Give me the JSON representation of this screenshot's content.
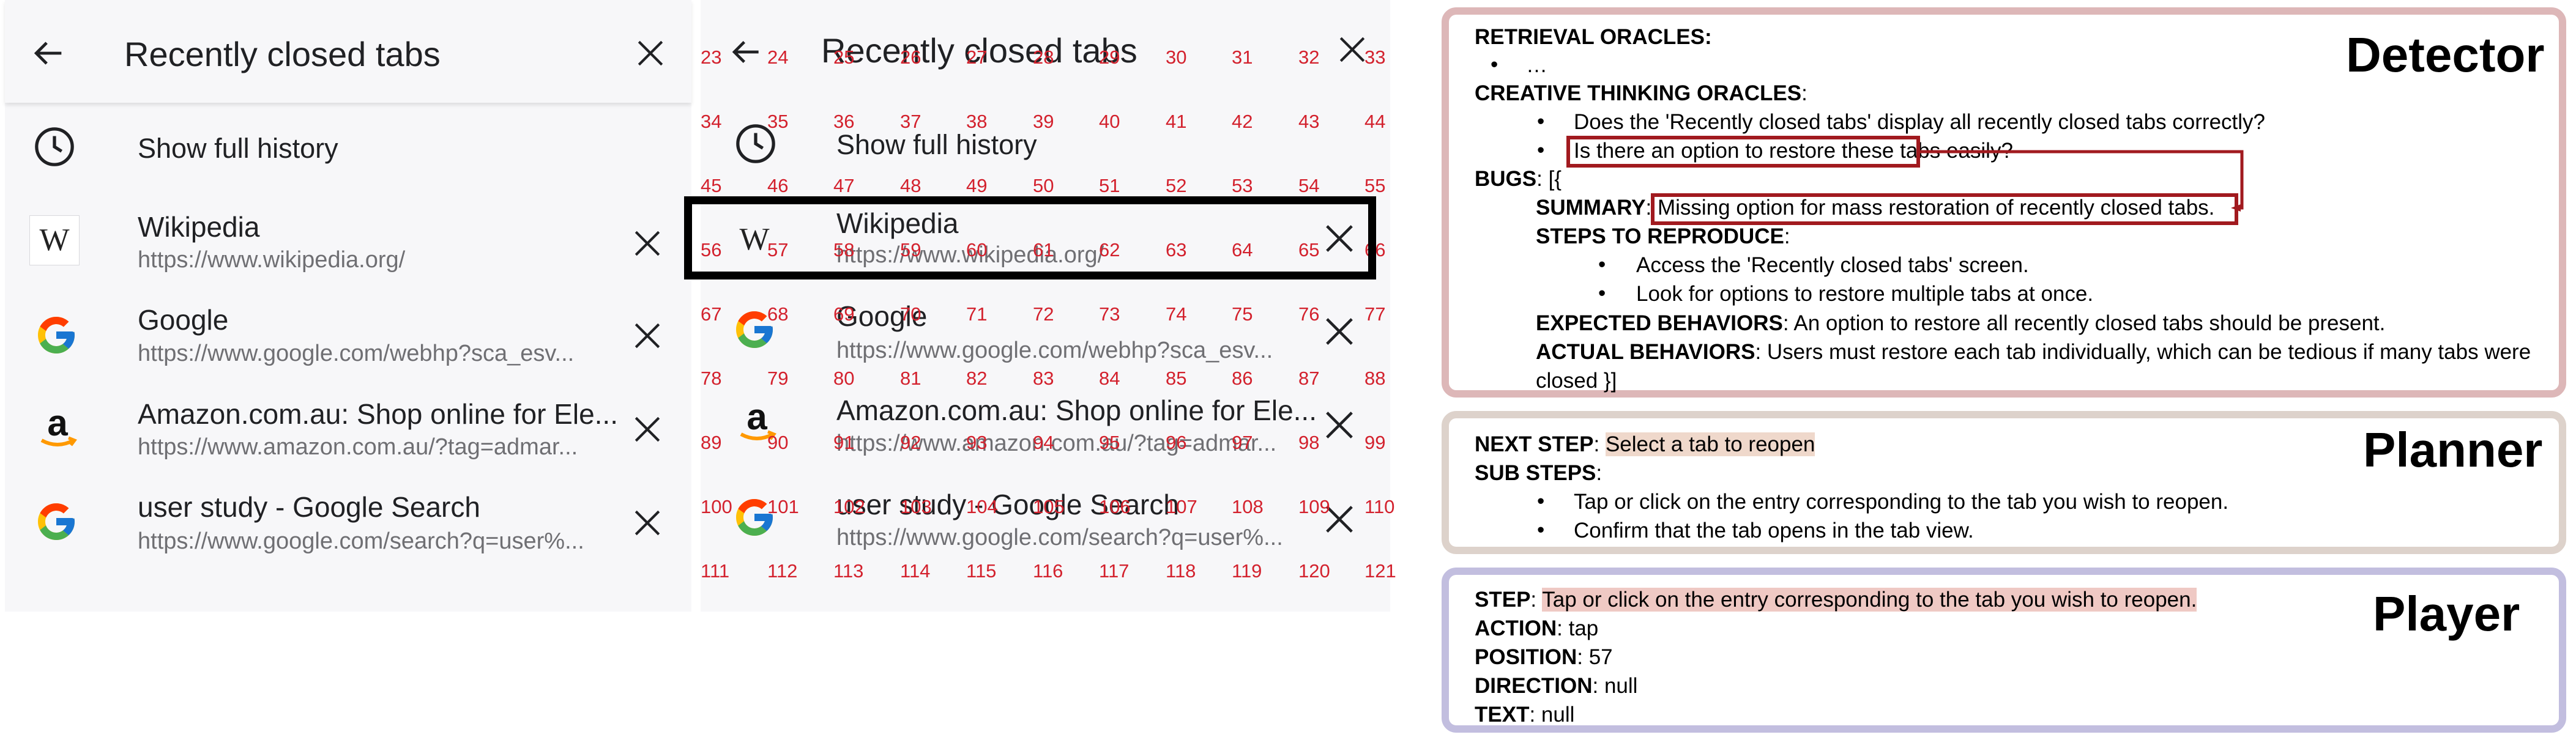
{
  "left_phone": {
    "title": "Recently closed tabs",
    "show_full_history": "Show full history",
    "rows": [
      {
        "title": "Wikipedia",
        "url": "https://www.wikipedia.org/",
        "icon": "wikipedia-icon"
      },
      {
        "title": "Google",
        "url": "https://www.google.com/webhp?sca_esv...",
        "icon": "google-icon"
      },
      {
        "title": "Amazon.com.au: Shop online for Ele...",
        "url": "https://www.amazon.com.au/?tag=admar...",
        "icon": "amazon-icon"
      },
      {
        "title": "user study - Google Search",
        "url": "https://www.google.com/search?q=user%...",
        "icon": "google-icon"
      }
    ]
  },
  "right_phone": {
    "title": "Recently closed tabs",
    "show_full_history": "Show full history",
    "rows": [
      {
        "title": "Wikipedia",
        "url": "https://www.wikipedia.org/"
      },
      {
        "title": "Google",
        "url": "https://www.google.com/webhp?sca_esv..."
      },
      {
        "title": "Amazon.com.au: Shop online for Ele...",
        "url": "https://www.amazon.com.au/?tag=admar..."
      },
      {
        "title": "user study - Google Search",
        "url": "https://www.google.com/search?q=user%..."
      }
    ],
    "grid_labels": [
      [
        "23",
        "24",
        "25",
        "26",
        "27",
        "28",
        "29",
        "30",
        "31",
        "32",
        "33"
      ],
      [
        "34",
        "35",
        "36",
        "37",
        "38",
        "39",
        "40",
        "41",
        "42",
        "43",
        "44"
      ],
      [
        "45",
        "46",
        "47",
        "48",
        "49",
        "50",
        "51",
        "52",
        "53",
        "54",
        "55"
      ],
      [
        "56",
        "57",
        "58",
        "59",
        "60",
        "61",
        "62",
        "63",
        "64",
        "65",
        "66"
      ],
      [
        "67",
        "68",
        "69",
        "70",
        "71",
        "72",
        "73",
        "74",
        "75",
        "76",
        "77"
      ],
      [
        "78",
        "79",
        "80",
        "81",
        "82",
        "83",
        "84",
        "85",
        "86",
        "87",
        "88"
      ],
      [
        "89",
        "90",
        "91",
        "92",
        "93",
        "94",
        "95",
        "96",
        "97",
        "98",
        "99"
      ],
      [
        "100",
        "101",
        "102",
        "103",
        "104",
        "105",
        "106",
        "107",
        "108",
        "109",
        "110"
      ],
      [
        "111",
        "112",
        "113",
        "114",
        "115",
        "116",
        "117",
        "118",
        "119",
        "120",
        "121"
      ]
    ]
  },
  "detector": {
    "title": "Detector",
    "retrieval_label": "RETRIEVAL ORACLES:",
    "retrieval_item": "…",
    "creative_label": "CREATIVE THINKING ORACLES",
    "creative_colon": ":",
    "creative_items": [
      "Does the 'Recently closed tabs' display all recently closed tabs correctly?",
      "Is there an option to restore these tabs easily?"
    ],
    "bugs_label": "BUGS",
    "bugs_open": ": [{",
    "summary_label": "SUMMARY",
    "summary_text": "Missing option for mass restoration of recently closed tabs.",
    "steps_label": "STEPS TO REPRODUCE",
    "steps_colon": ":",
    "steps": [
      "Access the 'Recently closed tabs' screen.",
      "Look for options to restore multiple tabs at once."
    ],
    "expected_label": "EXPECTED BEHAVIORS",
    "expected_text": ": An option to restore all recently closed tabs should be present.",
    "actual_label": "ACTUAL BEHAVIORS",
    "actual_text": ": Users must restore each tab individually, which can be tedious if many tabs were",
    "actual_text_2": "closed }]",
    "colon": ": "
  },
  "planner": {
    "title": "Planner",
    "next_step_label": "NEXT STEP",
    "next_step_text": "Select a tab to reopen",
    "sub_steps_label": "SUB STEPS",
    "sub_steps_colon": ":",
    "sub_steps": [
      "Tap or click on the entry corresponding to the tab you wish to reopen.",
      "Confirm that the tab opens in the tab view."
    ],
    "colon": ": "
  },
  "player": {
    "title": "Player",
    "step_label": "STEP",
    "step_text": "Tap or click on the entry corresponding to the tab you wish to reopen.",
    "action_label": "ACTION",
    "action_value": "tap",
    "position_label": "POSITION",
    "position_value": "57",
    "direction_label": "DIRECTION",
    "direction_value": "null",
    "text_label": "TEXT",
    "text_value": "null",
    "colon": ": "
  },
  "colors": {
    "grid_label_red": "#d3212d",
    "detector_border": "#ddb7b8",
    "planner_border": "#ddd2cb",
    "player_border": "#c2bedf",
    "highlight_box": "#a11a1f",
    "next_step_highlight": "#efd8cb",
    "step_highlight": "#efc9c4"
  }
}
